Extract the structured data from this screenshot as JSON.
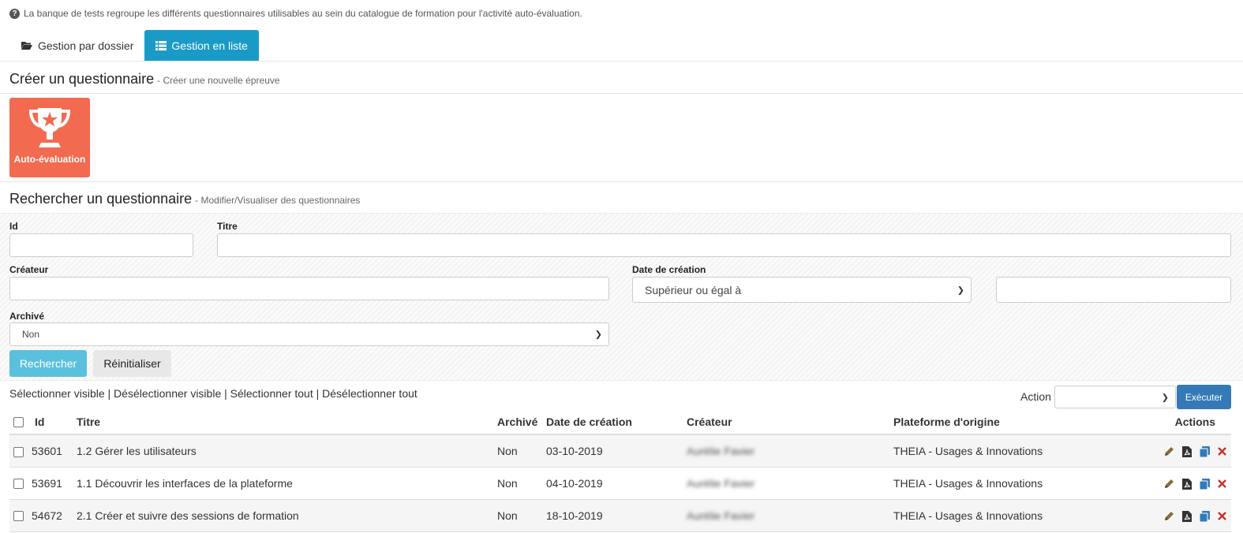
{
  "info_text": "La banque de tests regroupe les différents questionnaires utilisables au sein du catalogue de formation pour l'activité auto-évaluation.",
  "tabs": [
    {
      "label": "Gestion par dossier",
      "icon": "folder-open-icon",
      "active": false
    },
    {
      "label": "Gestion en liste",
      "icon": "list-icon",
      "active": true
    }
  ],
  "create": {
    "title": "Créer un questionnaire",
    "subtitle": "- Créer une nouvelle épreuve",
    "tile_label": "Auto-évaluation",
    "tile_icon": "trophy-icon"
  },
  "search": {
    "title": "Rechercher un questionnaire",
    "subtitle": "- Modifier/Visualiser des questionnaires",
    "id_label": "Id",
    "titre_label": "Titre",
    "createur_label": "Créateur",
    "date_label": "Date de création",
    "date_operator": "Supérieur ou égal à",
    "archive_label": "Archivé",
    "archive_value": "Non",
    "search_button": "Rechercher",
    "reset_button": "Réinitialiser"
  },
  "selection": {
    "select_visible": "Sélectionner visible",
    "deselect_visible": "Désélectionner visible",
    "select_all": "Sélectionner tout",
    "deselect_all": "Désélectionner tout",
    "separator": "|"
  },
  "bulk": {
    "action_label": "Action",
    "execute_button": "Exécuter"
  },
  "table": {
    "headers": [
      "Id",
      "Titre",
      "Archivé",
      "Date de création",
      "Créateur",
      "Plateforme d'origine",
      "Actions"
    ],
    "rows": [
      {
        "id": "53601",
        "titre": "1.2 Gérer les utilisateurs",
        "archive": "Non",
        "date": "03-10-2019",
        "createur": "Aurélie Favier",
        "plateforme": "THEIA - Usages & Innovations"
      },
      {
        "id": "53691",
        "titre": "1.1 Découvrir les interfaces de la plateforme",
        "archive": "Non",
        "date": "04-10-2019",
        "createur": "Aurélie Favier",
        "plateforme": "THEIA - Usages & Innovations"
      },
      {
        "id": "54672",
        "titre": "2.1 Créer et suivre des sessions de formation",
        "archive": "Non",
        "date": "18-10-2019",
        "createur": "Aurélie Favier",
        "plateforme": "THEIA - Usages & Innovations"
      }
    ],
    "action_icons": [
      "pencil-icon",
      "pdf-icon",
      "copy-icon",
      "delete-icon"
    ]
  },
  "colors": {
    "tab_active": "#1a9bc7",
    "tile": "#f26a4f",
    "search_button": "#5bc0de",
    "execute_button": "#337ab7",
    "delete": "#c9302c"
  }
}
